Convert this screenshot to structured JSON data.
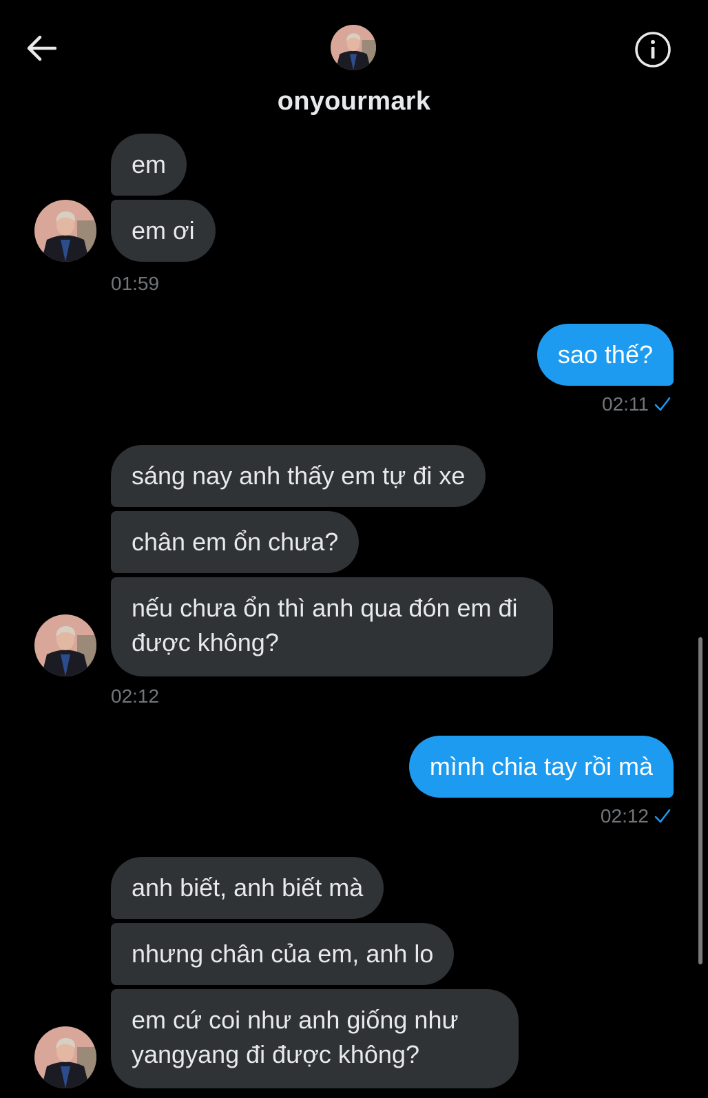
{
  "header": {
    "username": "onyourmark",
    "back_icon": "arrow-left-icon",
    "info_icon": "info-circle-icon"
  },
  "messages": [
    {
      "text": "em"
    },
    {
      "text": "em ơi"
    },
    {
      "time": "01:59"
    },
    {
      "text": "sao thế?"
    },
    {
      "time": "02:11"
    },
    {
      "text": "sáng nay anh thấy em tự đi xe"
    },
    {
      "text": "chân em ổn chưa?"
    },
    {
      "text": "nếu chưa ổn thì anh qua đón em đi được không?"
    },
    {
      "time": "02:12"
    },
    {
      "text": "mình chia tay rồi mà"
    },
    {
      "time": "02:12"
    },
    {
      "text": "anh biết, anh biết mà"
    },
    {
      "text": "nhưng chân của em, anh lo"
    },
    {
      "text": "em cứ coi như anh giống như yangyang đi được không?"
    }
  ],
  "colors": {
    "background": "#000000",
    "incoming_bubble": "#2f3336",
    "outgoing_bubble": "#1d9bf0",
    "timestamp": "#71767b",
    "read_check": "#1d9bf0"
  }
}
